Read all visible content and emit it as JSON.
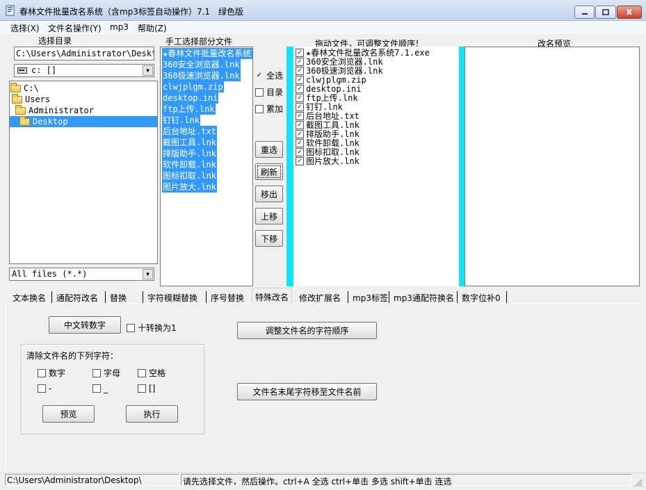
{
  "window": {
    "title": "春林文件批量改名系统（含mp3标签自动操作）7.1　绿色版",
    "min_icon": "minimize-icon",
    "max_icon": "maximize-icon",
    "close_icon": "close-icon",
    "close_glyph": "x"
  },
  "menu": [
    "选择(X)",
    "文件名操作(Y)",
    "mp3",
    "帮助(Z)"
  ],
  "headers": {
    "select_dir": "选择目录",
    "manual_select": "手工选择部分文件",
    "drag_order": "拖动文件，可调整文件顺序！",
    "rename_preview": "改名预览"
  },
  "left_panel": {
    "path": "C:\\Users\\Administrator\\Desktop\\",
    "drive": "c: []",
    "tree": [
      "C:\\",
      "Users",
      "Administrator",
      "Desktop"
    ],
    "filter": "All files (*.*)"
  },
  "files": [
    "★春林文件批量改名系统7.1.exe",
    "360安全浏览器.lnk",
    "360极速浏览器.lnk",
    "clwjplgm.zip",
    "desktop.ini",
    "ftp上传.lnk",
    "钉钉.lnk",
    "后台地址.txt",
    "截图工具.lnk",
    "排版助手.lnk",
    "软件卸载.lnk",
    "图标扣取.lnk",
    "图片放大.lnk"
  ],
  "options": {
    "select_all": "全选",
    "select_all_checked": true,
    "directory": "目录",
    "accumulate": "累加",
    "check_glyph": "✓"
  },
  "side_buttons": [
    "重选",
    "刷新",
    "移出",
    "上移",
    "下移"
  ],
  "tabs": [
    "文本换名",
    "通配符改名",
    "替换",
    "字符模糊替换",
    "序号替换",
    "特殊改名",
    "修改扩展名",
    "mp3标签",
    "mp3通配符换名",
    "数字位补0"
  ],
  "active_tab": 5,
  "special": {
    "cn_to_num": "中文转数字",
    "ten_to_one": "十转换为1",
    "adjust_order": "调整文件名的字符顺序",
    "move_tail": "文件名末尾字符移至文件名前",
    "clear_title": "清除文件名的下列字符：",
    "clear_opts": [
      "数字",
      "字母",
      "空格",
      "-",
      "_",
      "[]"
    ],
    "preview": "预览",
    "execute": "执行"
  },
  "status": {
    "path": "C:\\Users\\Administrator\\Desktop\\",
    "hint": "请先选择文件，然后操作。ctrl+A 全选 ctrl+单击 多选 shift+单击 连选"
  }
}
